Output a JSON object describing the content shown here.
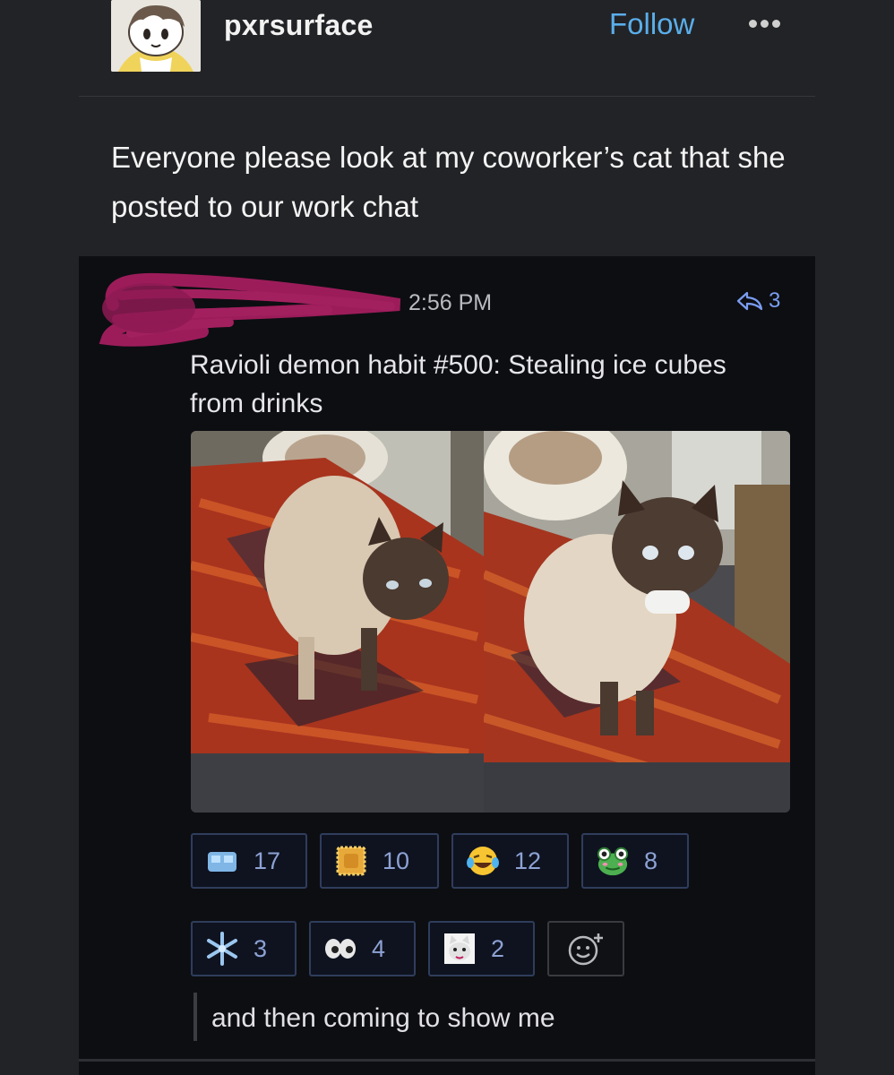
{
  "post": {
    "username": "pxrsurface",
    "follow_label": "Follow",
    "text": "Everyone please look at my coworker’s cat that she posted to our work chat"
  },
  "chat": {
    "timestamp": "2:56 PM",
    "reply_count": "3",
    "message": "Ravioli demon habit #500: Stealing ice cubes from drinks",
    "reactions": [
      {
        "icon": "ice-cube-icon",
        "count": "17"
      },
      {
        "icon": "ravioli-icon",
        "count": "10"
      },
      {
        "icon": "laughing-face-icon",
        "count": "12"
      },
      {
        "icon": "frog-icon",
        "count": "8"
      },
      {
        "icon": "snowflake-icon",
        "count": "3"
      },
      {
        "icon": "eyes-icon",
        "count": "4"
      },
      {
        "icon": "cat-face-icon",
        "count": "2"
      }
    ],
    "reply_text": "and then coming to show me"
  },
  "colors": {
    "background": "#222326",
    "chat_background": "#0d0e12",
    "follow_blue": "#5aaeea",
    "reaction_border": "#2f3d5c",
    "redaction": "#9c1c5a"
  }
}
